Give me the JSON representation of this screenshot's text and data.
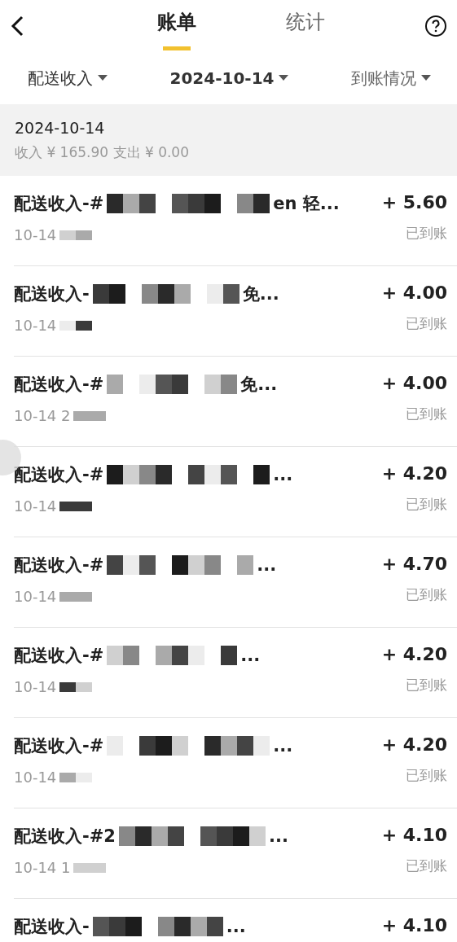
{
  "nav": {
    "tabs": [
      {
        "label": "账单",
        "selected": true
      },
      {
        "label": "统计",
        "selected": false
      }
    ]
  },
  "filters": [
    {
      "label": "配送收入",
      "emphasis": false
    },
    {
      "label": "2024-10-14",
      "emphasis": true
    },
    {
      "label": "到账情况",
      "emphasis": false,
      "muted": true
    }
  ],
  "summary": {
    "date": "2024-10-14",
    "totals": "收入 ¥ 165.90 支出 ¥ 0.00"
  },
  "records": [
    {
      "title_start": "配送收入-#",
      "title_end": "en 轻...",
      "time": "10-14",
      "amount": "+ 5.60",
      "status": "已到账"
    },
    {
      "title_start": "配送收入-",
      "title_end": "免...",
      "time": "10-14",
      "amount": "+ 4.00",
      "status": "已到账"
    },
    {
      "title_start": "配送收入-#",
      "title_end": "免...",
      "time": "10-14 2",
      "amount": "+ 4.00",
      "status": "已到账"
    },
    {
      "title_start": "配送收入-#",
      "title_end": "...",
      "time": "10-14",
      "amount": "+ 4.20",
      "status": "已到账"
    },
    {
      "title_start": "配送收入-#",
      "title_end": "...",
      "time": "10-14",
      "amount": "+ 4.70",
      "status": "已到账"
    },
    {
      "title_start": "配送收入-#",
      "title_end": "...",
      "time": "10-14",
      "amount": "+ 4.20",
      "status": "已到账"
    },
    {
      "title_start": "配送收入-#",
      "title_end": "...",
      "time": "10-14",
      "amount": "+ 4.20",
      "status": "已到账"
    },
    {
      "title_start": "配送收入-#2",
      "title_end": "...",
      "time": "10-14 1",
      "amount": "+ 4.10",
      "status": "已到账"
    },
    {
      "title_start": "配送收入-",
      "title_end": "...",
      "amount": "+ 4.10"
    }
  ]
}
